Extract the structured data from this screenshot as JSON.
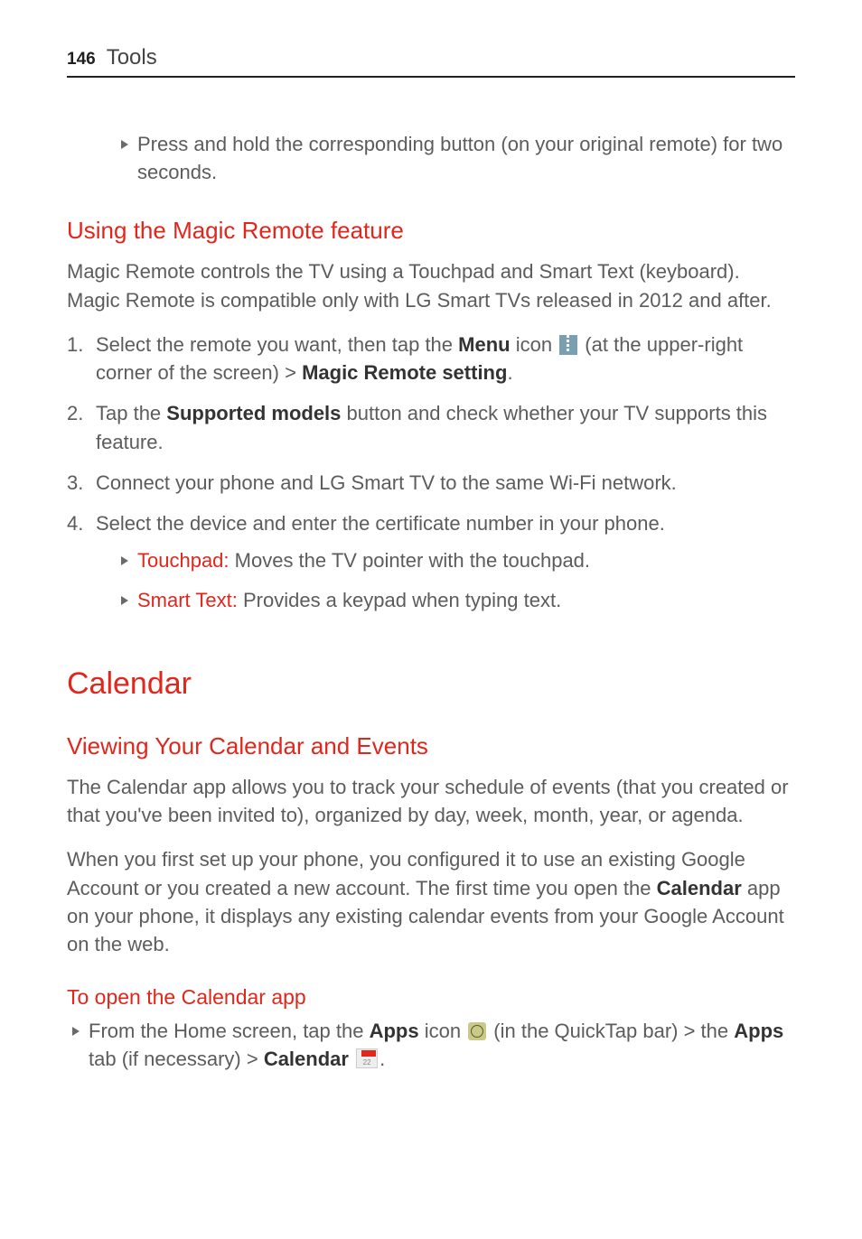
{
  "header": {
    "page_number": "146",
    "section": "Tools"
  },
  "intro_bullet": "Press and hold the corresponding button (on your original remote) for two seconds.",
  "magic_remote": {
    "heading": "Using the Magic Remote feature",
    "intro": "Magic Remote controls the TV using a Touchpad and Smart Text (keyboard). Magic Remote is compatible only with LG Smart TVs released in 2012 and after.",
    "steps": {
      "s1_pre": "Select the remote you want, then tap the ",
      "s1_menu_bold": "Menu",
      "s1_icon_label": " icon ",
      "s1_mid": " (at the upper-right corner of the screen) > ",
      "s1_mrs_bold": "Magic Remote setting",
      "s1_tail": ".",
      "s2_pre": "Tap the ",
      "s2_bold": "Supported models",
      "s2_tail": " button and check whether your TV supports this feature.",
      "s3": "Connect your phone and LG Smart TV to the same Wi-Fi network.",
      "s4": "Select the device and enter the certificate number in your phone.",
      "s4_bullets": {
        "touchpad_label": "Touchpad:",
        "touchpad_desc": " Moves the TV pointer with the touchpad.",
        "smarttext_label": "Smart Text:",
        "smarttext_desc": " Provides a keypad when typing text."
      }
    }
  },
  "calendar": {
    "heading": "Calendar",
    "sub_heading": "Viewing Your Calendar and Events",
    "p1": "The Calendar app allows you to track your schedule of events (that you created or that you've been invited to), organized by day, week, month, year, or agenda.",
    "p2_pre": "When you first set up your phone, you configured it to use an existing Google Account or you created a new account. The first time you open the ",
    "p2_cal_bold": "Calendar",
    "p2_tail": " app on your phone, it displays any existing calendar events from your Google Account on the web.",
    "open_heading": "To open the Calendar app",
    "open_bullet": {
      "pre": "From the Home screen, tap the ",
      "apps_bold": "Apps",
      "icon_lbl": " icon ",
      "mid": " (in the QuickTap bar) > the ",
      "apps2_bold": "Apps",
      "tab_txt": " tab (if necessary) > ",
      "cal_bold": "Calendar",
      "tail": "."
    }
  },
  "markers": {
    "n1": "1.",
    "n2": "2.",
    "n3": "3.",
    "n4": "4."
  }
}
